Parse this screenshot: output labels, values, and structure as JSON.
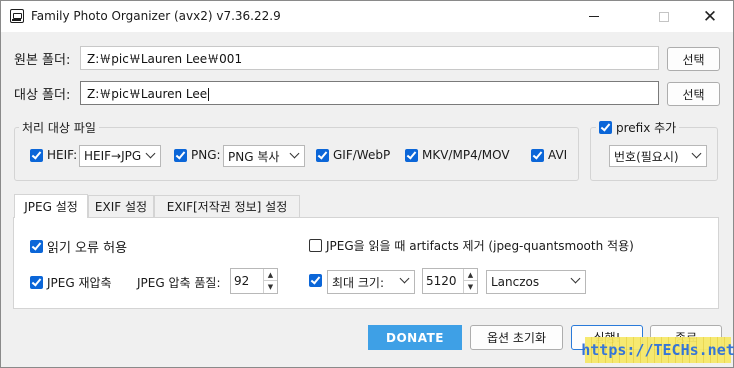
{
  "window": {
    "title": "Family Photo Organizer (avx2) v7.36.22.9",
    "minimize_icon": "minimize-icon",
    "maximize_icon": "maximize-icon",
    "close_glyph": "✕"
  },
  "source": {
    "label": "원본 폴더:",
    "value": "Z:￦pic￦Lauren Lee￦001",
    "button": "선택"
  },
  "target": {
    "label": "대상 폴더:",
    "value": "Z:￦pic￦Lauren Lee",
    "button": "선택"
  },
  "files_group": {
    "title": "처리 대상 파일",
    "heif_label": "HEIF:",
    "heif_checked": true,
    "heif_option": "HEIF→JPG",
    "png_label": "PNG:",
    "png_checked": true,
    "png_option": "PNG 복사",
    "gif_label": "GIF/WebP",
    "gif_checked": true,
    "mkv_label": "MKV/MP4/MOV",
    "mkv_checked": true,
    "avi_label": "AVI",
    "avi_checked": true
  },
  "prefix_group": {
    "title": "prefix 추가",
    "checked": true,
    "option": "번호(필요시)"
  },
  "tabs": [
    {
      "label": "JPEG 설정",
      "active": true
    },
    {
      "label": "EXIF 설정",
      "active": false
    },
    {
      "label": "EXIF[저작권 정보] 설정",
      "active": false
    }
  ],
  "jpeg": {
    "ignore_errors_label": "읽기 오류 허용",
    "ignore_errors_checked": true,
    "artifacts_label": "JPEG을 읽을 때 artifacts 제거 (jpeg-quantsmooth 적용)",
    "artifacts_checked": false,
    "recompress_label": "JPEG 재압축",
    "recompress_checked": true,
    "quality_label": "JPEG 압축 품질:",
    "quality_value": "92",
    "maxsize_checked": true,
    "maxsize_option": "최대 크기:",
    "maxsize_value": "5120",
    "resample_option": "Lanczos"
  },
  "footer": {
    "donate": "DONATE",
    "reset": "옵션 초기화",
    "run": "실행!",
    "exit": "종료"
  },
  "watermark_text": "https://TECHs.net",
  "colors": {
    "checkbox": "#0b66d8",
    "donate": "#3ea0e6"
  }
}
